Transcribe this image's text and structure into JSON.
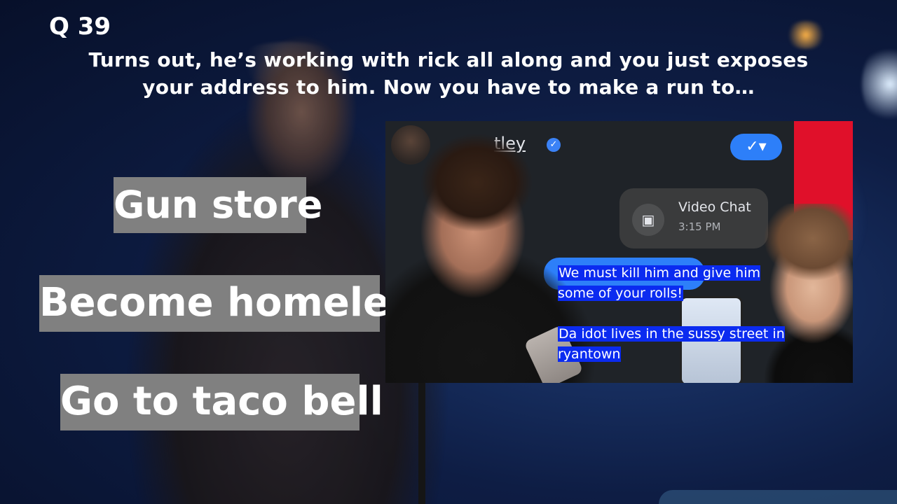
{
  "question": {
    "number": "Q 39",
    "text": "Turns out, he’s working with rick all along and you just exposes your address to him. Now you have to make a run to…"
  },
  "answers": [
    {
      "label": "Gun store"
    },
    {
      "label": "Become homeless"
    },
    {
      "label": "Go to taco bell"
    }
  ],
  "meme": {
    "contact_name": "tley",
    "video_chat": {
      "title": "Video Chat",
      "time": "3:15 PM"
    },
    "overlay_lines": [
      "We must kill him and give him some of your rolls!",
      "Da idot lives in the sussy street in ryantown"
    ],
    "icons": {
      "verified": "verified-icon",
      "video": "video-camera-icon",
      "check": "check-icon"
    },
    "colors": {
      "accent_red": "#e0102a",
      "messenger_blue": "#2d7ff9",
      "overlay_highlight": "#0b2bf0"
    }
  },
  "colors": {
    "answer_box": "#808080",
    "text": "#ffffff"
  }
}
